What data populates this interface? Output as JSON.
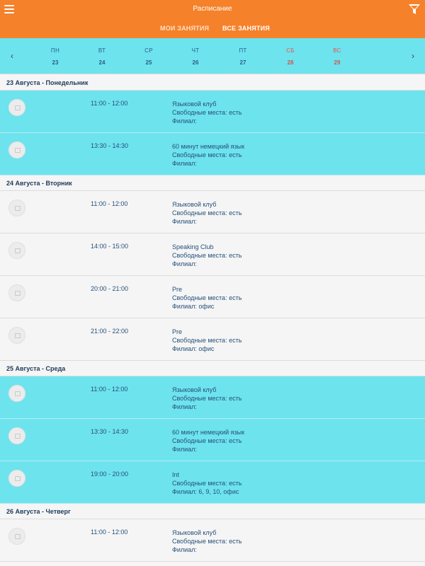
{
  "header": {
    "title": "Расписание",
    "menu_icon": "hamburger-icon",
    "filter_icon": "filter-icon",
    "tabs": [
      {
        "label": "МОИ ЗАНЯТИЯ",
        "active": false
      },
      {
        "label": "ВСЕ ЗАНЯТИЯ",
        "active": true
      }
    ]
  },
  "week": {
    "prev_icon": "chevron-left-icon",
    "next_icon": "chevron-right-icon",
    "days": [
      {
        "name": "ПН",
        "date": "23"
      },
      {
        "name": "ВТ",
        "date": "24"
      },
      {
        "name": "СР",
        "date": "25"
      },
      {
        "name": "ЧТ",
        "date": "26"
      },
      {
        "name": "ПТ",
        "date": "27"
      },
      {
        "name": "СБ",
        "date": "28"
      },
      {
        "name": "ВС",
        "date": "29"
      }
    ]
  },
  "colors": {
    "header": "#f5812a",
    "highlight": "#6de3ee",
    "text": "#26507a",
    "weekend": "#e0574b"
  },
  "sections": [
    {
      "title": "23 Августа - Понедельник",
      "rows": [
        {
          "time": "11:00 - 12:00",
          "name": "Языковой клуб",
          "seats": "Свободные места: есть",
          "branch": "Филиал:",
          "highlighted": true
        },
        {
          "time": "13:30 - 14:30",
          "name": "60 минут немецкий язык",
          "seats": "Свободные места: есть",
          "branch": "Филиал:",
          "highlighted": true
        }
      ]
    },
    {
      "title": "24 Августа - Вторник",
      "rows": [
        {
          "time": "11:00 - 12:00",
          "name": "Языковой клуб",
          "seats": "Свободные места: есть",
          "branch": "Филиал:",
          "highlighted": false
        },
        {
          "time": "14:00 - 15:00",
          "name": "Speaking Club",
          "seats": "Свободные места: есть",
          "branch": "Филиал:",
          "highlighted": false
        },
        {
          "time": "20:00 - 21:00",
          "name": "Pre",
          "seats": "Свободные места: есть",
          "branch": "Филиал: офис",
          "highlighted": false
        },
        {
          "time": "21:00 - 22:00",
          "name": "Pre",
          "seats": "Свободные места: есть",
          "branch": "Филиал: офис",
          "highlighted": false
        }
      ]
    },
    {
      "title": "25 Августа - Среда",
      "rows": [
        {
          "time": "11:00 - 12:00",
          "name": "Языковой клуб",
          "seats": "Свободные места: есть",
          "branch": "Филиал:",
          "highlighted": true
        },
        {
          "time": "13:30 - 14:30",
          "name": "60 минут немецкий язык",
          "seats": "Свободные места: есть",
          "branch": "Филиал:",
          "highlighted": true
        },
        {
          "time": "19:00 - 20:00",
          "name": "Int",
          "seats": "Свободные места: есть",
          "branch": "Филиал: 6, 9, 10, офис",
          "highlighted": true
        }
      ]
    },
    {
      "title": "26 Августа - Четверг",
      "rows": [
        {
          "time": "11:00 - 12:00",
          "name": "Языковой клуб",
          "seats": "Свободные места: есть",
          "branch": "Филиал:",
          "highlighted": false
        }
      ]
    }
  ]
}
